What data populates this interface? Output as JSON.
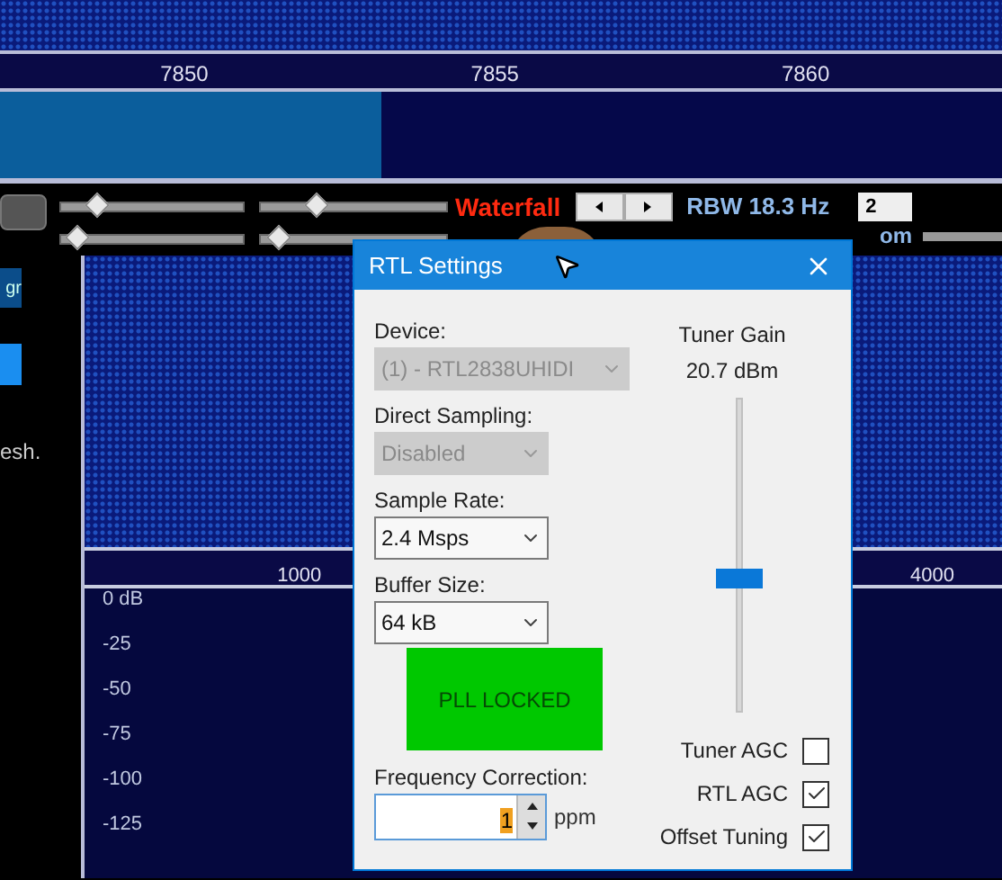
{
  "frequency_axis": {
    "labels": [
      "7850",
      "7855",
      "7860"
    ]
  },
  "toolbar": {
    "sliders": [
      {
        "level": 0.2
      },
      {
        "level": 0.3
      },
      {
        "level": 0.1
      },
      {
        "level": 0.1
      }
    ],
    "mode_label": "Waterfall",
    "rbw": "RBW 18.3 Hz",
    "field_value": "2",
    "partial_label": "om"
  },
  "sidebar": {
    "button_label": "gr",
    "partial_text": "esh."
  },
  "waterfall_axis": {
    "labels": [
      "1000",
      "4000"
    ]
  },
  "spectrum": {
    "db_labels": [
      "0 dB",
      "-25",
      "-50",
      "-75",
      "-100",
      "-125"
    ]
  },
  "dialog": {
    "title": "RTL Settings",
    "selects": [
      {
        "label": "Device:",
        "value": "(1) - RTL2838UHIDI",
        "disabled": true,
        "wide": true
      },
      {
        "label": "Direct Sampling:",
        "value": "Disabled",
        "disabled": true,
        "wide": false
      },
      {
        "label": "Sample Rate:",
        "value": "2.4 Msps",
        "disabled": false,
        "wide": false
      },
      {
        "label": "Buffer Size:",
        "value": "64 kB",
        "disabled": false,
        "wide": false
      }
    ],
    "pll": {
      "text": "PLL LOCKED",
      "locked": true
    },
    "frequency_correction": {
      "label": "Frequency Correction:",
      "value": "1",
      "unit": "ppm"
    },
    "tuner_gain": {
      "title": "Tuner Gain",
      "reading": "20.7 dBm",
      "level": 0.43
    },
    "checkboxes": [
      {
        "label": "Tuner AGC",
        "checked": false
      },
      {
        "label": "RTL AGC",
        "checked": true
      },
      {
        "label": "Offset Tuning",
        "checked": true
      }
    ]
  }
}
